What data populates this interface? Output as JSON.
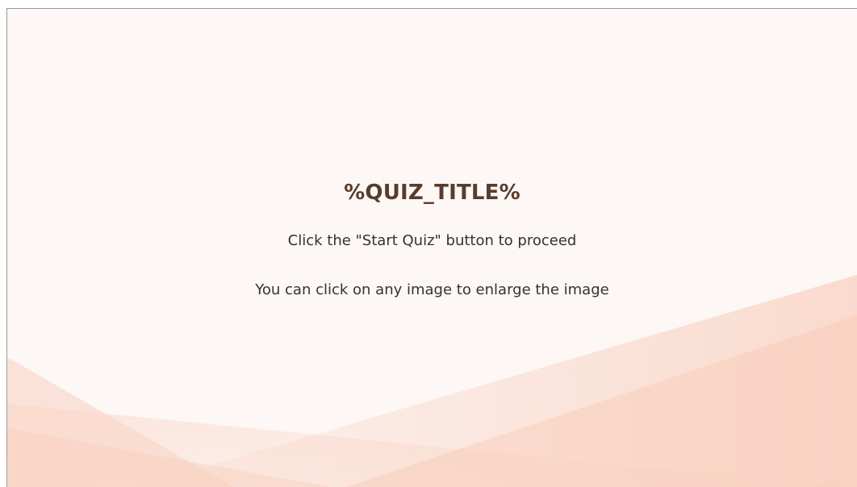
{
  "intro": {
    "title": "%QUIZ_TITLE%",
    "instruction": "Click the \"Start Quiz\" button to proceed",
    "image_hint": "You can click on any image to enlarge the image"
  },
  "colors": {
    "background": "#fdf7f5",
    "title": "#5a3c2c",
    "text": "#333333",
    "accent_shape": "#f6c9b6"
  }
}
